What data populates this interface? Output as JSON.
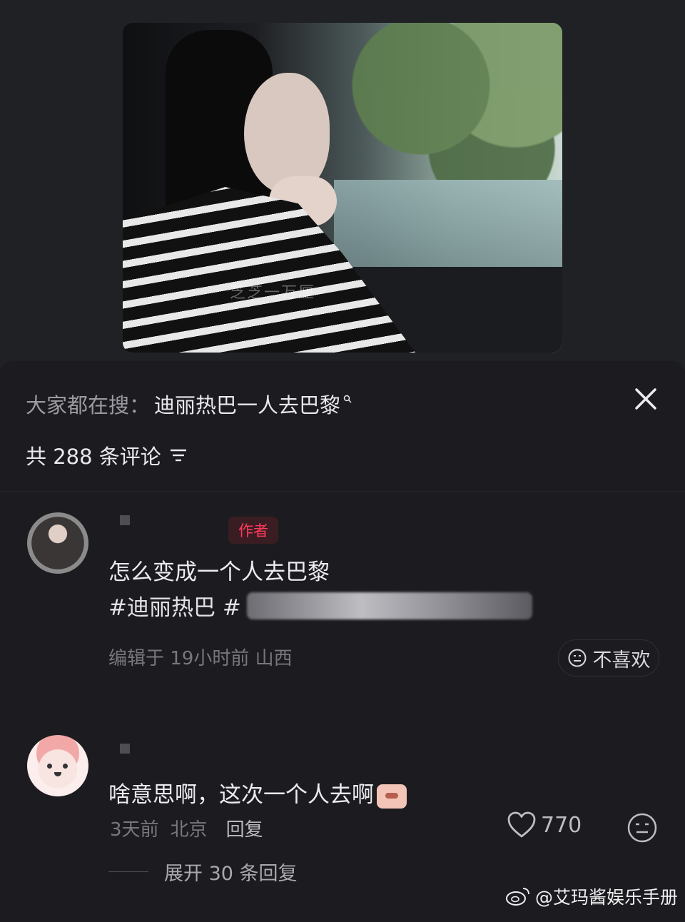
{
  "video": {
    "watermark": "芝芝一万厘"
  },
  "search": {
    "prefix": "大家都在搜：",
    "keyword": "迪丽热巴一人去巴黎"
  },
  "comments_header": {
    "count_label": "共 288 条评论"
  },
  "comments": [
    {
      "badge": "作者",
      "text": "怎么变成一个人去巴黎",
      "hashtags": "#迪丽热巴 #",
      "meta": "编辑于 19小时前 山西",
      "dislike_label": "不喜欢"
    },
    {
      "text": "啥意思啊，这次一个人去啊",
      "meta_time": "3天前",
      "meta_location": "北京",
      "reply_label": "回复",
      "like_count": "770",
      "expand_label": "展开 30 条回复"
    }
  ],
  "footer": {
    "weibo_handle": "@艾玛酱娱乐手册"
  },
  "colors": {
    "background": "#171719",
    "sheet": "#1c1c20",
    "badge_text": "#ff3b5c",
    "muted": "#77777d"
  },
  "icons": [
    "search-mini-icon",
    "close-icon",
    "sort-icon",
    "dislike-face-icon",
    "heart-icon",
    "neutral-face-icon",
    "weibo-logo-icon"
  ]
}
